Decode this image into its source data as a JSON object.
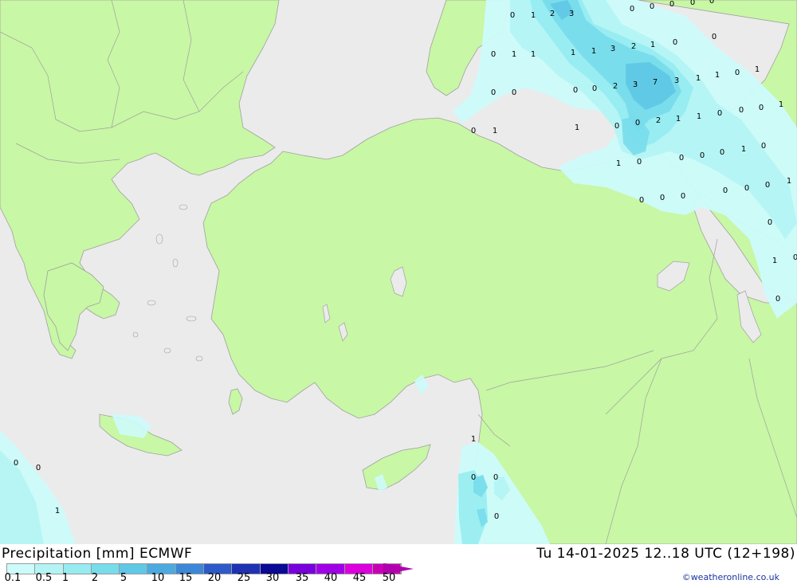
{
  "map": {
    "colors": {
      "sea": "#ebebeb",
      "land": "#c8f7a5",
      "border": "#a0a0a0"
    },
    "precip_labels": [
      {
        "v": "0"
      },
      {
        "v": "1"
      },
      {
        "v": "2"
      },
      {
        "v": "3"
      },
      {
        "v": "0"
      },
      {
        "v": "0"
      },
      {
        "v": "0"
      },
      {
        "v": "0"
      },
      {
        "v": "0"
      },
      {
        "v": "0"
      },
      {
        "v": "1"
      },
      {
        "v": "1"
      },
      {
        "v": "1"
      },
      {
        "v": "1"
      },
      {
        "v": "3"
      },
      {
        "v": "2"
      },
      {
        "v": "1"
      },
      {
        "v": "0"
      },
      {
        "v": "0"
      },
      {
        "v": "0"
      },
      {
        "v": "0"
      },
      {
        "v": "0"
      },
      {
        "v": "0"
      },
      {
        "v": "2"
      },
      {
        "v": "3"
      },
      {
        "v": "7"
      },
      {
        "v": "3"
      },
      {
        "v": "1"
      },
      {
        "v": "1"
      },
      {
        "v": "0"
      },
      {
        "v": "1"
      },
      {
        "v": "0"
      },
      {
        "v": "1"
      },
      {
        "v": "1"
      },
      {
        "v": "0"
      },
      {
        "v": "0"
      },
      {
        "v": "2"
      },
      {
        "v": "1"
      },
      {
        "v": "1"
      },
      {
        "v": "0"
      },
      {
        "v": "0"
      },
      {
        "v": "0"
      },
      {
        "v": "1"
      },
      {
        "v": "1"
      },
      {
        "v": "0"
      },
      {
        "v": "0"
      },
      {
        "v": "0"
      },
      {
        "v": "0"
      },
      {
        "v": "1"
      },
      {
        "v": "0"
      },
      {
        "v": "0"
      },
      {
        "v": "0"
      },
      {
        "v": "0"
      },
      {
        "v": "0"
      },
      {
        "v": "0"
      },
      {
        "v": "0"
      },
      {
        "v": "1"
      },
      {
        "v": "0"
      },
      {
        "v": "1"
      },
      {
        "v": "0"
      },
      {
        "v": "0"
      },
      {
        "v": "0"
      },
      {
        "v": "0"
      },
      {
        "v": "1"
      },
      {
        "v": "0"
      },
      {
        "v": "0"
      },
      {
        "v": "1"
      },
      {
        "v": "0"
      },
      {
        "v": "0"
      }
    ]
  },
  "footer": {
    "title_left": "Precipitation [mm] ECMWF",
    "title_right": "Tu 14-01-2025 12..18 UTC (12+198)",
    "credit": "©weatheronline.co.uk",
    "legend": {
      "labels": [
        "0.1",
        "0.5",
        "1",
        "2",
        "5",
        "10",
        "15",
        "20",
        "25",
        "30",
        "35",
        "40",
        "45",
        "50"
      ],
      "colors": [
        "#cdfbfb",
        "#b4f4f4",
        "#96ecf0",
        "#78dceb",
        "#5fc8e6",
        "#4baae0",
        "#3c87d7",
        "#2d5ac8",
        "#1e32b4",
        "#0a0a96",
        "#7800dc",
        "#a000e6",
        "#dc00dc",
        "#c800b4"
      ]
    }
  }
}
